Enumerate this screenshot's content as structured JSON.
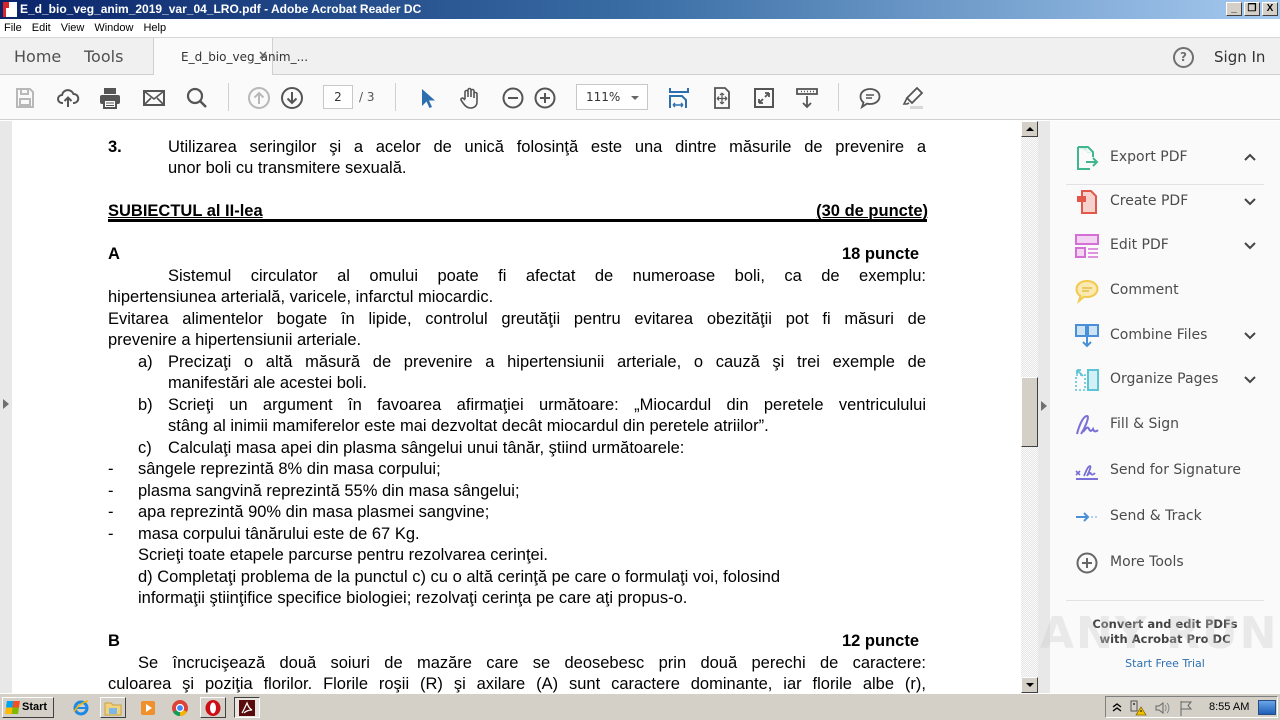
{
  "window": {
    "title": "E_d_bio_veg_anim_2019_var_04_LRO.pdf - Adobe Acrobat Reader DC",
    "controls": {
      "minimize": "_",
      "restore": "❐",
      "close": "X"
    }
  },
  "menu": [
    "File",
    "Edit",
    "View",
    "Window",
    "Help"
  ],
  "nav": {
    "home": "Home",
    "tools": "Tools",
    "doc_tab": "E_d_bio_veg_anim_...",
    "doc_tab_close": "×",
    "help": "?",
    "sign_in": "Sign In"
  },
  "toolbar": {
    "icons": [
      "save-icon",
      "upload-cloud-icon",
      "print-icon",
      "email-icon",
      "search-icon",
      "page-up-icon",
      "page-down-icon",
      "select-cursor-icon",
      "hand-icon",
      "zoom-out-icon",
      "zoom-in-icon",
      "fit-width-icon",
      "fit-page-icon",
      "full-screen-icon",
      "scroll-mode-icon",
      "comment-icon",
      "highlight-icon"
    ],
    "current_page": "2",
    "total_pages": "/ 3",
    "zoom": "111%"
  },
  "document": {
    "item3_num": "3.",
    "item3_line1": "Utilizarea seringilor şi a acelor de unică folosinţă este una dintre măsurile de prevenire a",
    "item3_line2": "unor boli cu transmitere sexuală.",
    "subject_title": "SUBIECTUL al II-lea",
    "subject_points": "(30 de puncte)",
    "sectionA_label": "A",
    "sectionA_points": "18 puncte",
    "A_p1_line1": "Sistemul circulator al omului poate fi afectat de numeroase boli, ca de exemplu:",
    "A_p1_line2": "hipertensiunea arterială, varicele, infarctul miocardic.",
    "A_p2_line1": "Evitarea alimentelor bogate în lipide, controlul greutăţii pentru evitarea obezităţii pot fi măsuri de",
    "A_p2_line2": "prevenire a hipertensiunii arteriale.",
    "a_label": "a)",
    "a_line1": "Precizaţi o altă măsură de prevenire a hipertensiunii arteriale, o cauză şi trei exemple de",
    "a_line2": "manifestări ale acestei boli.",
    "b_label": "b)",
    "b_line1": "Scrieţi un argument în favoarea afirmaţiei următoare: „Miocardul din peretele ventriculului",
    "b_line2": "stâng al inimii mamiferelor este mai dezvoltat decât miocardul din peretele atriilor”.",
    "c_label": "c)",
    "c_line1": "Calculaţi masa apei din plasma sângelui unui tânăr, ştiind următoarele:",
    "bullets": [
      "sângele reprezintă 8% din masa corpului;",
      "plasma sangvină reprezintă 55% din masa sângelui;",
      "apa reprezintă 90% din masa plasmei sangvine;",
      "masa corpului tânărului este de 67 Kg."
    ],
    "bullet_mark": "-",
    "c_line_final": "Scrieţi toate etapele parcurse pentru rezolvarea cerinţei.",
    "d_line1": "d)  Completaţi problema de la punctul c) cu o altă cerinţă pe care o formulaţi voi, folosind",
    "d_line2": "informaţii ştiinţifice specifice biologiei; rezolvaţi cerinţa pe care aţi propus-o.",
    "sectionB_label": "B",
    "sectionB_points": "12 puncte",
    "B_line1": "Se încrucişează două soiuri de mazăre care se deosebesc prin două perechi de caractere:",
    "B_line2": "culoarea şi poziţia florilor. Florile roşii (R) şi axilare (A) sunt caractere dominante, iar florile albe (r),"
  },
  "tools_pane": {
    "items": [
      {
        "label": "Export PDF",
        "icon": "export-pdf-icon",
        "chevron": "up"
      },
      {
        "label": "Create PDF",
        "icon": "create-pdf-icon",
        "chevron": "down"
      },
      {
        "label": "Edit PDF",
        "icon": "edit-pdf-icon",
        "chevron": "down"
      },
      {
        "label": "Comment",
        "icon": "comment-bubble-icon",
        "chevron": ""
      },
      {
        "label": "Combine Files",
        "icon": "combine-files-icon",
        "chevron": "down"
      },
      {
        "label": "Organize Pages",
        "icon": "organize-pages-icon",
        "chevron": "down"
      },
      {
        "label": "Fill & Sign",
        "icon": "fill-sign-icon",
        "chevron": ""
      },
      {
        "label": "Send for Signature",
        "icon": "send-signature-icon",
        "chevron": ""
      },
      {
        "label": "Send & Track",
        "icon": "send-track-icon",
        "chevron": ""
      },
      {
        "label": "More Tools",
        "icon": "more-tools-icon",
        "chevron": ""
      }
    ],
    "promo_line1": "Convert and edit PDFs",
    "promo_line2": "with Acrobat Pro DC",
    "promo_link": "Start Free Trial"
  },
  "watermark": "ANY RUN",
  "taskbar": {
    "start": "Start",
    "apps": [
      "internet-explorer-icon",
      "file-explorer-icon",
      "media-player-icon",
      "chrome-icon",
      "opera-icon",
      "acrobat-reader-icon"
    ],
    "clock": "8:55 AM"
  },
  "colors": {
    "accent_blue": "#2d6fae",
    "export_green": "#3fb68e",
    "create_red": "#e3574a",
    "edit_pink": "#d46fd6",
    "comment_yellow": "#f2c94c",
    "combine_blue": "#4a90d9",
    "organize_teal": "#5bc4d6",
    "sign_purple": "#7a6fd6"
  }
}
